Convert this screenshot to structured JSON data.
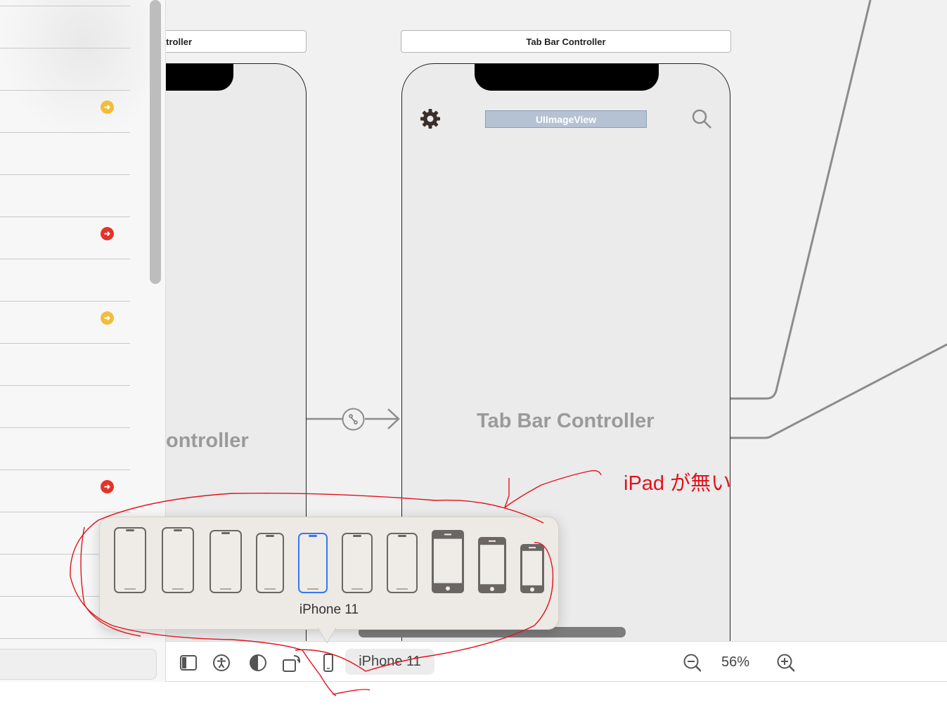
{
  "scenes": {
    "left": {
      "label": "troller",
      "title": "ontroller"
    },
    "right": {
      "label": "Tab Bar Controller",
      "title": "Tab Bar Controller",
      "image_view": "UIImageView"
    }
  },
  "device_picker": {
    "selected_device": "iPhone 11",
    "device_count": 10,
    "selected_index": 4
  },
  "toolbar": {
    "device_label": "iPhone 11",
    "zoom": "56%"
  },
  "annotation": {
    "text": "iPad が無い",
    "color": "#e2131d"
  },
  "outline": {
    "badges": [
      {
        "color": "yellow",
        "icon": "arrow-right-icon"
      },
      {
        "color": "red",
        "icon": "arrow-right-icon"
      },
      {
        "color": "yellow",
        "icon": "arrow-right-icon"
      },
      {
        "color": "red",
        "icon": "arrow-right-icon"
      }
    ]
  },
  "colors": {
    "accent": "#3478f6",
    "badge_yellow": "#f1bd3b",
    "badge_red": "#e3342b"
  }
}
